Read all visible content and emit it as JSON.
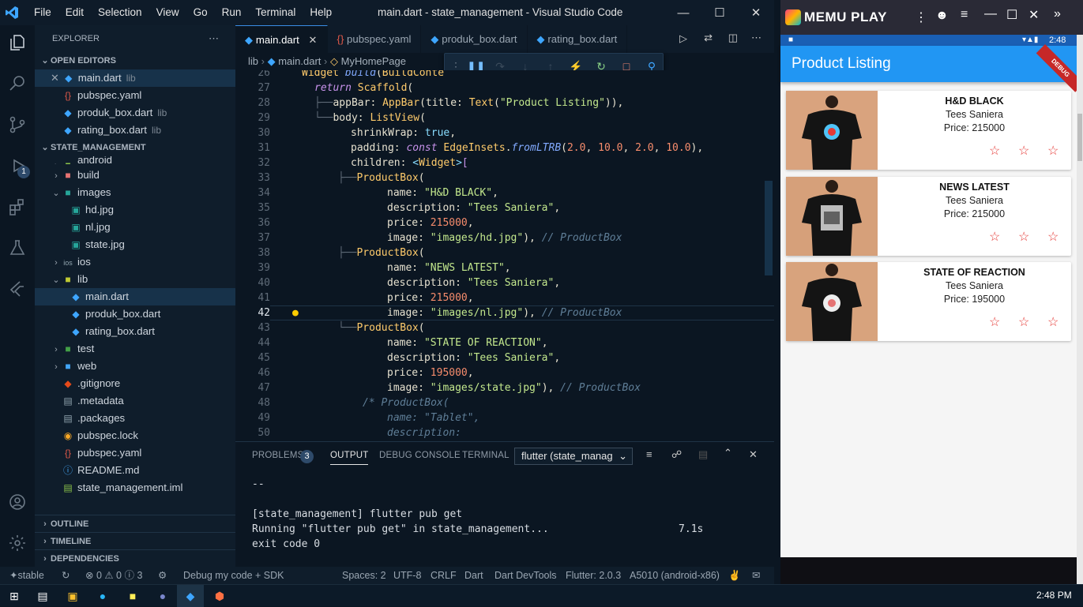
{
  "window": {
    "title": "main.dart - state_management - Visual Studio Code",
    "menu": [
      "File",
      "Edit",
      "Selection",
      "View",
      "Go",
      "Run",
      "Terminal",
      "Help"
    ]
  },
  "activity": {
    "debug_badge": "1"
  },
  "explorer": {
    "header": "EXPLORER",
    "open_editors_label": "OPEN EDITORS",
    "open_editors": [
      {
        "name": "main.dart",
        "dir": "lib"
      },
      {
        "name": "pubspec.yaml",
        "dir": ""
      },
      {
        "name": "produk_box.dart",
        "dir": "lib"
      },
      {
        "name": "rating_box.dart",
        "dir": "lib"
      }
    ],
    "project_label": "STATE_MANAGEMENT",
    "tree": [
      "android",
      "build",
      "images",
      "hd.jpg",
      "nl.jpg",
      "state.jpg",
      "ios",
      "lib",
      "main.dart",
      "produk_box.dart",
      "rating_box.dart",
      "test",
      "web",
      ".gitignore",
      ".metadata",
      ".packages",
      "pubspec.lock",
      "pubspec.yaml",
      "README.md",
      "state_management.iml"
    ],
    "outline": "OUTLINE",
    "timeline": "TIMELINE",
    "dependencies": "DEPENDENCIES"
  },
  "tabs": [
    "main.dart",
    "pubspec.yaml",
    "produk_box.dart",
    "rating_box.dart"
  ],
  "breadcrumb": [
    "lib",
    "main.dart",
    "MyHomePage"
  ],
  "editor": {
    "current_line": "42",
    "line_numbers": [
      "26",
      "27",
      "28",
      "29",
      "30",
      "31",
      "32",
      "33",
      "34",
      "35",
      "36",
      "37",
      "38",
      "39",
      "40",
      "41",
      "42",
      "43",
      "44",
      "45",
      "46",
      "47",
      "48",
      "49",
      "50"
    ]
  },
  "panel": {
    "tabs": [
      "PROBLEMS",
      "OUTPUT",
      "DEBUG CONSOLE",
      "TERMINAL"
    ],
    "problems_count": "3",
    "output_select": "flutter (state_manag",
    "lines": [
      "--",
      "",
      "[state_management] flutter pub get",
      "Running \"flutter pub get\" in state_management...                     7.1s",
      "exit code 0"
    ]
  },
  "status": {
    "branch": "stable",
    "problems": "⊗ 0 ⚠ 0 ⓘ 3",
    "debug": "Debug my code + SDK",
    "spaces": "Spaces: 2",
    "encoding": "UTF-8",
    "eol": "CRLF",
    "lang": "Dart",
    "devtools": "Dart DevTools",
    "flutter": "Flutter: 2.0.3",
    "device": "A5010 (android-x86)"
  },
  "emulator": {
    "brand": "MEMU PLAY",
    "clock": "2:48",
    "app_title": "Product Listing",
    "debug_ribbon": "DEBUG",
    "products": [
      {
        "name": "H&D BLACK",
        "description": "Tees Saniera",
        "price": "Price: 215000"
      },
      {
        "name": "NEWS LATEST",
        "description": "Tees Saniera",
        "price": "Price: 215000"
      },
      {
        "name": "STATE OF REACTION",
        "description": "Tees Saniera",
        "price": "Price: 195000"
      }
    ]
  },
  "taskbar": {
    "time": "2:48 PM"
  }
}
